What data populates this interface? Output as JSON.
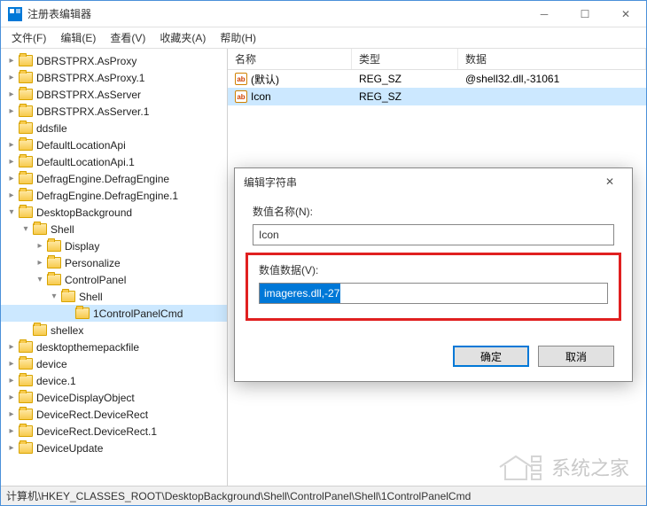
{
  "title": "注册表编辑器",
  "menu": {
    "file": "文件(F)",
    "edit": "编辑(E)",
    "view": "查看(V)",
    "favorites": "收藏夹(A)",
    "help": "帮助(H)"
  },
  "tree": [
    {
      "level": 0,
      "exp": "▸",
      "label": "DBRSTPRX.AsProxy"
    },
    {
      "level": 0,
      "exp": "▸",
      "label": "DBRSTPRX.AsProxy.1"
    },
    {
      "level": 0,
      "exp": "▸",
      "label": "DBRSTPRX.AsServer"
    },
    {
      "level": 0,
      "exp": "▸",
      "label": "DBRSTPRX.AsServer.1"
    },
    {
      "level": 0,
      "exp": "",
      "label": "ddsfile"
    },
    {
      "level": 0,
      "exp": "▸",
      "label": "DefaultLocationApi"
    },
    {
      "level": 0,
      "exp": "▸",
      "label": "DefaultLocationApi.1"
    },
    {
      "level": 0,
      "exp": "▸",
      "label": "DefragEngine.DefragEngine"
    },
    {
      "level": 0,
      "exp": "▸",
      "label": "DefragEngine.DefragEngine.1"
    },
    {
      "level": 0,
      "exp": "▾",
      "label": "DesktopBackground"
    },
    {
      "level": 1,
      "exp": "▾",
      "label": "Shell"
    },
    {
      "level": 2,
      "exp": "▸",
      "label": "Display"
    },
    {
      "level": 2,
      "exp": "▸",
      "label": "Personalize"
    },
    {
      "level": 2,
      "exp": "▾",
      "label": "ControlPanel"
    },
    {
      "level": 3,
      "exp": "▾",
      "label": "Shell"
    },
    {
      "level": 4,
      "exp": "",
      "label": "1ControlPanelCmd",
      "selected": true
    },
    {
      "level": 1,
      "exp": "",
      "label": "shellex"
    },
    {
      "level": 0,
      "exp": "▸",
      "label": "desktopthemepackfile"
    },
    {
      "level": 0,
      "exp": "▸",
      "label": "device"
    },
    {
      "level": 0,
      "exp": "▸",
      "label": "device.1"
    },
    {
      "level": 0,
      "exp": "▸",
      "label": "DeviceDisplayObject"
    },
    {
      "level": 0,
      "exp": "▸",
      "label": "DeviceRect.DeviceRect"
    },
    {
      "level": 0,
      "exp": "▸",
      "label": "DeviceRect.DeviceRect.1"
    },
    {
      "level": 0,
      "exp": "▸",
      "label": "DeviceUpdate"
    }
  ],
  "list": {
    "headers": {
      "name": "名称",
      "type": "类型",
      "data": "数据"
    },
    "rows": [
      {
        "name": "(默认)",
        "type": "REG_SZ",
        "data": "@shell32.dll,-31061"
      },
      {
        "name": "Icon",
        "type": "REG_SZ",
        "data": "",
        "selected": true
      }
    ]
  },
  "status": "计算机\\HKEY_CLASSES_ROOT\\DesktopBackground\\Shell\\ControlPanel\\Shell\\1ControlPanelCmd",
  "dialog": {
    "title": "编辑字符串",
    "name_label": "数值名称(N):",
    "name_value": "Icon",
    "data_label": "数值数据(V):",
    "data_value": "imageres.dll,-27",
    "ok": "确定",
    "cancel": "取消"
  },
  "watermark": "系统之家"
}
